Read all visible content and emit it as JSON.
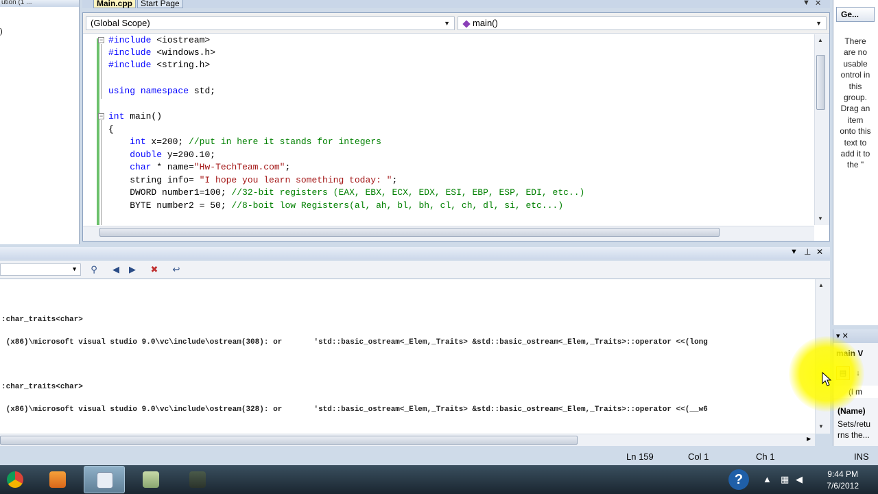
{
  "left_panel": {
    "header": "ution (1 ...",
    "row_text": ")"
  },
  "document_tabs": [
    {
      "label": "Main.cpp"
    },
    {
      "label": "Start Page"
    }
  ],
  "tab_controls": {
    "dropdown": "▼",
    "close": "✕"
  },
  "navigation_bar": {
    "scope": "(Global Scope)",
    "member": "main()"
  },
  "code_lines": [
    {
      "html_kind": "pp",
      "text": "#include <iostream>"
    },
    {
      "html_kind": "pp",
      "text": "#include <windows.h>"
    },
    {
      "html_kind": "pp",
      "text": "#include <string.h>"
    },
    {
      "html_kind": "blank",
      "text": ""
    },
    {
      "html_kind": "using",
      "text": "using namespace std;"
    },
    {
      "html_kind": "blank",
      "text": ""
    },
    {
      "html_kind": "main",
      "text": "int main()"
    },
    {
      "html_kind": "plain",
      "text": "{"
    },
    {
      "html_kind": "int",
      "text": "    int x=200; //put in here it stands for integers"
    },
    {
      "html_kind": "double",
      "text": "    double y=200.10;"
    },
    {
      "html_kind": "char",
      "text": "    char * name=\"Hw-TechTeam.com\";"
    },
    {
      "html_kind": "string",
      "text": "    string info= \"I hope you learn something today: \";"
    },
    {
      "html_kind": "dword",
      "text": "    DWORD number1=100; //32-bit registers (EAX, EBX, ECX, EDX, ESI, EBP, ESP, EDI, etc..)"
    },
    {
      "html_kind": "byte",
      "text": "    BYTE number2 = 50; //8-boit low Registers(al, ah, bl, bh, cl, ch, dl, si, etc...)"
    }
  ],
  "toolbox": {
    "tab_label": "Ge...",
    "message": "There are no usable ontrol in this group. Drag an item onto this text to add it to the \""
  },
  "properties": {
    "header_controls": "▾ ✕",
    "object": "main V",
    "row_value": "(l m",
    "selected_name": "(Name)",
    "description": "Sets/retu rns the..."
  },
  "output": {
    "lines": [
      {
        "text": ":char_traits<char>"
      },
      {
        "text": " (x86)\\microsoft visual studio 9.0\\vc\\include\\ostream(308): or       'std::basic_ostream<_Elem,_Traits> &std::basic_ostream<_Elem,_Traits>::operator <<(long"
      },
      {
        "text": ":char_traits<char>"
      },
      {
        "text": " (x86)\\microsoft visual studio 9.0\\vc\\include\\ostream(328): or       'std::basic_ostream<_Elem,_Traits> &std::basic_ostream<_Elem,_Traits>::operator <<(__w6"
      }
    ]
  },
  "status_bar": {
    "line": "Ln 159",
    "col": "Col 1",
    "ch": "Ch 1",
    "mode": "INS"
  },
  "taskbar": {
    "apps": [
      {
        "name": "chrome-icon"
      },
      {
        "name": "media-player-icon"
      },
      {
        "name": "visual-studio-icon"
      },
      {
        "name": "notepad-icon"
      },
      {
        "name": "camtasia-icon"
      }
    ],
    "clock_time": "9:44 PM",
    "clock_date": "7/6/2012",
    "help_glyph": "?"
  },
  "colors": {
    "keyword": "#0000ff",
    "comment": "#008000",
    "string": "#a31515",
    "cursor_highlight": "#ffff00"
  }
}
